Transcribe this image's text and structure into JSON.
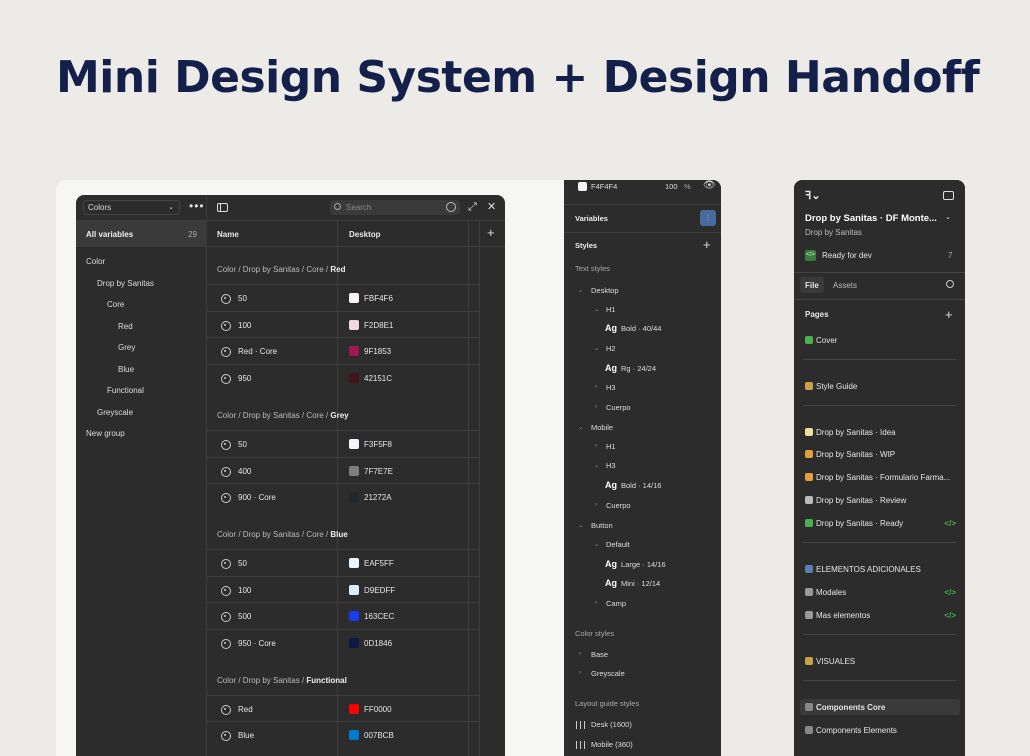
{
  "title": "Mini Design System + Design Handoff",
  "variables": {
    "collection": "Colors",
    "all_label": "All variables",
    "all_count": "29",
    "tree": [
      "Color",
      "Drop by Sanitas",
      "Core",
      "Red",
      "Grey",
      "Blue",
      "Functional",
      "Greyscale",
      "New group"
    ],
    "search_placeholder": "Search",
    "col_name": "Name",
    "col_desktop": "Desktop",
    "groups": [
      {
        "prefix": "Color / Drop by Sanitas / Core / ",
        "name": "Red",
        "rows": [
          {
            "n": "50",
            "hex": "FBF4F6",
            "c": "#FBF4F6"
          },
          {
            "n": "100",
            "hex": "F2D8E1",
            "c": "#F2D8E1"
          },
          {
            "n": "Red · Core",
            "hex": "9F1853",
            "c": "#9F1853"
          },
          {
            "n": "950",
            "hex": "42151C",
            "c": "#42151C"
          }
        ]
      },
      {
        "prefix": "Color / Drop by Sanitas / Core / ",
        "name": "Grey",
        "rows": [
          {
            "n": "50",
            "hex": "F3F5F8",
            "c": "#F3F5F8"
          },
          {
            "n": "400",
            "hex": "7F7E7E",
            "c": "#7F7E7E"
          },
          {
            "n": "900 · Core",
            "hex": "21272A",
            "c": "#21272A"
          }
        ]
      },
      {
        "prefix": "Color / Drop by Sanitas / Core / ",
        "name": "Blue",
        "rows": [
          {
            "n": "50",
            "hex": "EAF5FF",
            "c": "#EAF5FF"
          },
          {
            "n": "100",
            "hex": "D9EDFF",
            "c": "#D9EDFF"
          },
          {
            "n": "500",
            "hex": "163CEC",
            "c": "#163CEC"
          },
          {
            "n": "950 · Core",
            "hex": "0D1846",
            "c": "#0D1846"
          }
        ]
      },
      {
        "prefix": "Color / Drop by Sanitas / ",
        "name": "Functional",
        "rows": [
          {
            "n": "Red",
            "hex": "FF0000",
            "c": "#FF0000"
          },
          {
            "n": "Blue",
            "hex": "007BCB",
            "c": "#007BCB"
          }
        ]
      }
    ]
  },
  "styles": {
    "fill_hex": "F4F4F4",
    "fill_opacity": "100",
    "fill_pct": "%",
    "variables": "Variables",
    "styles": "Styles",
    "text_styles": "Text styles",
    "desktop": "Desktop",
    "h1": "H1",
    "h1_spec": "Bold · 40/44",
    "h2": "H2",
    "h2_spec": "Rg · 24/24",
    "h3": "H3",
    "cuerpo": "Cuerpo",
    "mobile": "Mobile",
    "m_h1": "H1",
    "m_h3": "H3",
    "m_h3_spec": "Bold · 14/16",
    "m_cuerpo": "Cuerpo",
    "button": "Button",
    "default": "Default",
    "large": "Large · 14/16",
    "mini": "Mini · 12/14",
    "camp": "Camp",
    "ag": "Ag",
    "color_styles": "Color styles",
    "base": "Base",
    "greyscale": "Greyscale",
    "layout_styles": "Layout guide styles",
    "desk": "Desk (1600)",
    "mobile_grid": "Mobile (360)"
  },
  "file": {
    "name": "Drop by Sanitas · DF Monte...",
    "team": "Drop by Sanitas",
    "ready": "Ready for dev",
    "ready_count": "7",
    "tab_file": "File",
    "tab_assets": "Assets",
    "pages": "Pages",
    "items": [
      "Cover",
      "Style Guide",
      "Drop by Sanitas · Idea",
      "Drop by Sanitas · WIP",
      "Drop by Sanitas · Formulario Farma...",
      "Drop by Sanitas · Review",
      "Drop by Sanitas · Ready",
      "ELEMENTOS ADICIONALES",
      "Modales",
      "Mas elementos",
      "VISUALES",
      "Components Core",
      "Components Elements"
    ],
    "code": "</>"
  }
}
